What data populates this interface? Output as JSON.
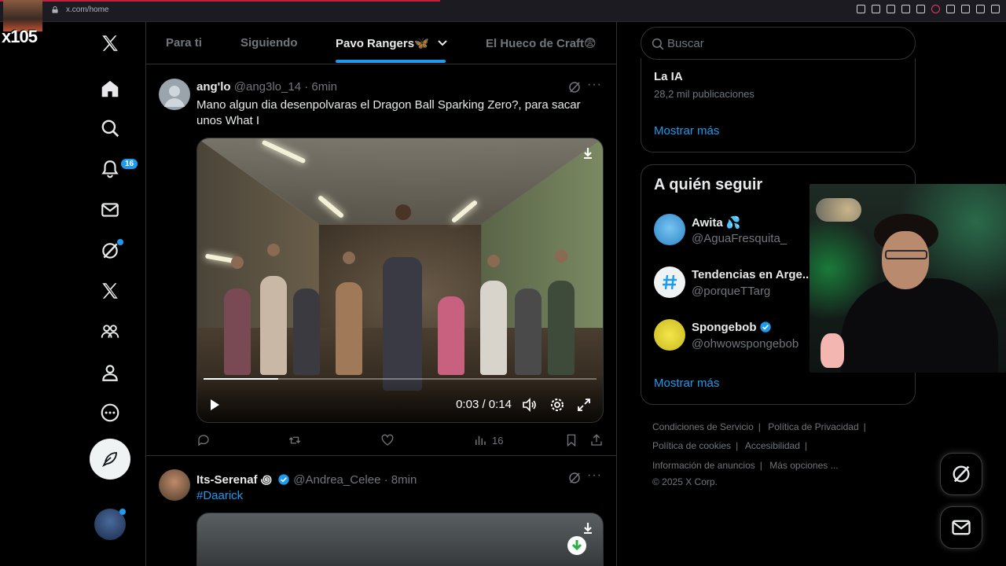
{
  "browser": {
    "url": "x.com/home"
  },
  "overlay": {
    "counter": "x105"
  },
  "nav": {
    "notifications_badge": "16"
  },
  "tabs": [
    {
      "label": "Para ti"
    },
    {
      "label": "Siguiendo"
    },
    {
      "label": "Pavo Rangers🦋"
    },
    {
      "label": "El Hueco de Craft😨"
    }
  ],
  "posts": [
    {
      "name": "ang'lo",
      "handle": "@ang3lo_14",
      "time": "6min",
      "text": "Mano algun dia desenpolvaras el Dragon Ball Sparking Zero?, para sacar unos What I",
      "video": {
        "time": "0:03 / 0:14",
        "progress": 0.19
      },
      "views": "16"
    },
    {
      "name": "Its-Serenaf ꩜",
      "handle": "@Andrea_Celee",
      "time": "8min",
      "text": "#Daarick"
    }
  ],
  "search": {
    "placeholder": "Buscar"
  },
  "trend": {
    "title": "La IA",
    "subtitle": "28,2 mil publicaciones",
    "show_more": "Mostrar más"
  },
  "who_to_follow": {
    "title": "A quién seguir",
    "accounts": [
      {
        "name": "Awita 💦",
        "handle": "@AguaFresquita_"
      },
      {
        "name": "Tendencias en Arge...",
        "handle": "@porqueTTarg"
      },
      {
        "name": "Spongebob",
        "handle": "@ohwowspongebob"
      }
    ],
    "show_more": "Mostrar más"
  },
  "footer": {
    "links": [
      "Condiciones de Servicio",
      "Política de Privacidad",
      "Política de cookies",
      "Accesibilidad",
      "Información de anuncios",
      "Más opciones ..."
    ],
    "copyright": "© 2025 X Corp."
  },
  "colors": {
    "accent": "#1d9bf0",
    "background": "#000000",
    "border": "#2f3336",
    "muted": "#71767b"
  }
}
